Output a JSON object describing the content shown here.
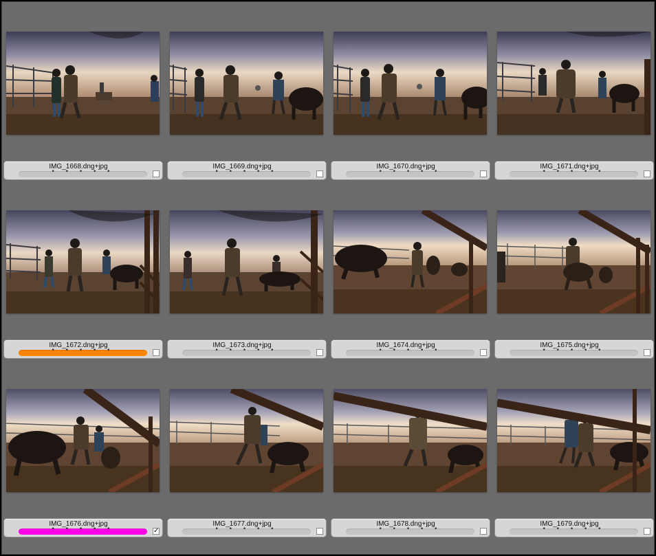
{
  "photos": [
    {
      "filename": "IMG_1668.dng+jpg",
      "stars": "• • • • •",
      "color_label": "",
      "checked": false,
      "check_mark": ""
    },
    {
      "filename": "IMG_1669.dng+jpg",
      "stars": "• • • • •",
      "color_label": "",
      "checked": false,
      "check_mark": ""
    },
    {
      "filename": "IMG_1670.dng+jpg",
      "stars": "• • • • •",
      "color_label": "",
      "checked": false,
      "check_mark": ""
    },
    {
      "filename": "IMG_1671.dng+jpg",
      "stars": "• • • • •",
      "color_label": "",
      "checked": false,
      "check_mark": ""
    },
    {
      "filename": "IMG_1672.dng+jpg",
      "stars": "• • • • •",
      "color_label": "#ff8400",
      "checked": false,
      "check_mark": ""
    },
    {
      "filename": "IMG_1673.dng+jpg",
      "stars": "• • • • •",
      "color_label": "",
      "checked": false,
      "check_mark": ""
    },
    {
      "filename": "IMG_1674.dng+jpg",
      "stars": "• • • • •",
      "color_label": "",
      "checked": false,
      "check_mark": ""
    },
    {
      "filename": "IMG_1675.dng+jpg",
      "stars": "• • • • •",
      "color_label": "",
      "checked": false,
      "check_mark": ""
    },
    {
      "filename": "IMG_1676.dng+jpg",
      "stars": "• • • • •",
      "color_label": "#ff00e8",
      "checked": true,
      "check_mark": "✓"
    },
    {
      "filename": "IMG_1677.dng+jpg",
      "stars": "• • • • •",
      "color_label": "",
      "checked": false,
      "check_mark": ""
    },
    {
      "filename": "IMG_1678.dng+jpg",
      "stars": "• • • • •",
      "color_label": "",
      "checked": false,
      "check_mark": ""
    },
    {
      "filename": "IMG_1679.dng+jpg",
      "stars": "• • • • •",
      "color_label": "",
      "checked": false,
      "check_mark": ""
    }
  ],
  "colors": {
    "background": "#6b6b6b",
    "label_bar": "#d6d6d6",
    "rating_track": "#c4c4c4",
    "label_orange": "#ff8400",
    "label_magenta": "#ff00e8"
  }
}
